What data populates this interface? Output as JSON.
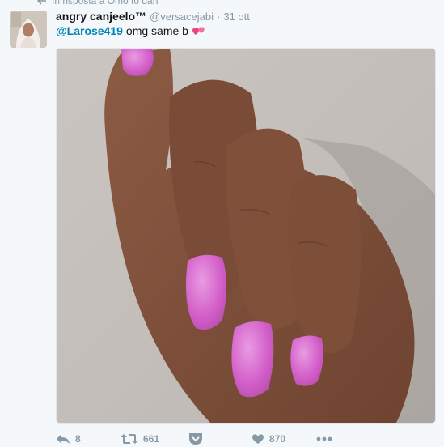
{
  "reply_context": {
    "text": "In risposta a Omo to dah"
  },
  "tweet": {
    "author_name": "angry canjeelo™",
    "author_handle": "@versacejabi",
    "separator": "·",
    "timestamp": "31 ott",
    "mention": "@Larose419",
    "text": "omg same b",
    "emoji": "two-hearts-icon",
    "media_description": "hand with glittery pink nails"
  },
  "actions": {
    "reply_count": "8",
    "retweet_count": "661",
    "like_count": "870"
  },
  "colors": {
    "background": "#f5f8fa",
    "mention": "#0084b4",
    "muted": "#8899a6",
    "nail": "#d35fc9"
  }
}
